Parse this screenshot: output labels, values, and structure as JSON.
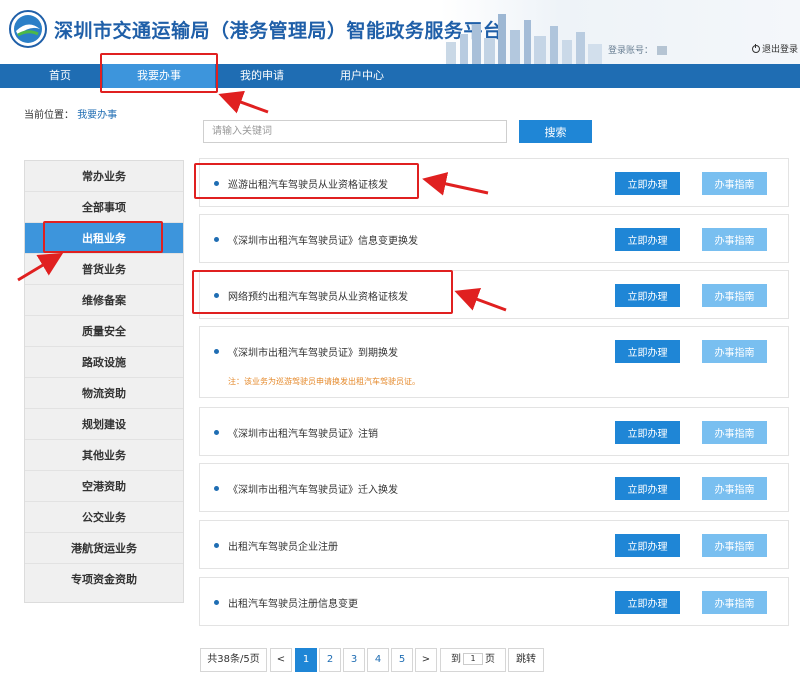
{
  "header": {
    "title": "深圳市交通运输局（港务管理局）智能政务服务平台",
    "account_label": "登录账号：",
    "logout_label": "退出登录"
  },
  "nav": {
    "items": [
      "首页",
      "我要办事",
      "我的申请",
      "用户中心"
    ],
    "active": "我要办事"
  },
  "breadcrumb": {
    "label": "当前位置：",
    "current": "我要办事"
  },
  "search": {
    "placeholder": "请输入关键词",
    "button": "搜索"
  },
  "sidebar": {
    "items": [
      "常办业务",
      "全部事项",
      "出租业务",
      "普货业务",
      "维修备案",
      "质量安全",
      "路政设施",
      "物流资助",
      "规划建设",
      "其他业务",
      "空港资助",
      "公交业务",
      "港航货运业务",
      "专项资金资助"
    ],
    "active": "出租业务"
  },
  "services": [
    {
      "title": "巡游出租汽车驾驶员从业资格证核发",
      "note": "",
      "do_label": "立即办理",
      "guide_label": "办事指南"
    },
    {
      "title": "《深圳市出租汽车驾驶员证》信息变更换发",
      "note": "",
      "do_label": "立即办理",
      "guide_label": "办事指南"
    },
    {
      "title": "网络预约出租汽车驾驶员从业资格证核发",
      "note": "",
      "do_label": "立即办理",
      "guide_label": "办事指南"
    },
    {
      "title": "《深圳市出租汽车驾驶员证》到期换发",
      "note": "注：该业务为巡游驾驶员申请换发出租汽车驾驶员证。",
      "do_label": "立即办理",
      "guide_label": "办事指南"
    },
    {
      "title": "《深圳市出租汽车驾驶员证》注销",
      "note": "",
      "do_label": "立即办理",
      "guide_label": "办事指南"
    },
    {
      "title": "《深圳市出租汽车驾驶员证》迁入换发",
      "note": "",
      "do_label": "立即办理",
      "guide_label": "办事指南"
    },
    {
      "title": "出租汽车驾驶员企业注册",
      "note": "",
      "do_label": "立即办理",
      "guide_label": "办事指南"
    },
    {
      "title": "出租汽车驾驶员注册信息变更",
      "note": "",
      "do_label": "立即办理",
      "guide_label": "办事指南"
    }
  ],
  "pagination": {
    "summary": "共38条/5页",
    "prev": "<",
    "pages": [
      "1",
      "2",
      "3",
      "4",
      "5"
    ],
    "current": "1",
    "next": ">",
    "goto_prefix": "到",
    "goto_value": "1",
    "goto_suffix": "页",
    "jump": "跳转"
  },
  "colors": {
    "nav_bg": "#1f6db3",
    "active_tab": "#3d95dc",
    "primary_button": "#1f86d6",
    "guide_button": "#79bff0",
    "annotation_red": "#e02020",
    "note_orange": "#e58a2c"
  }
}
